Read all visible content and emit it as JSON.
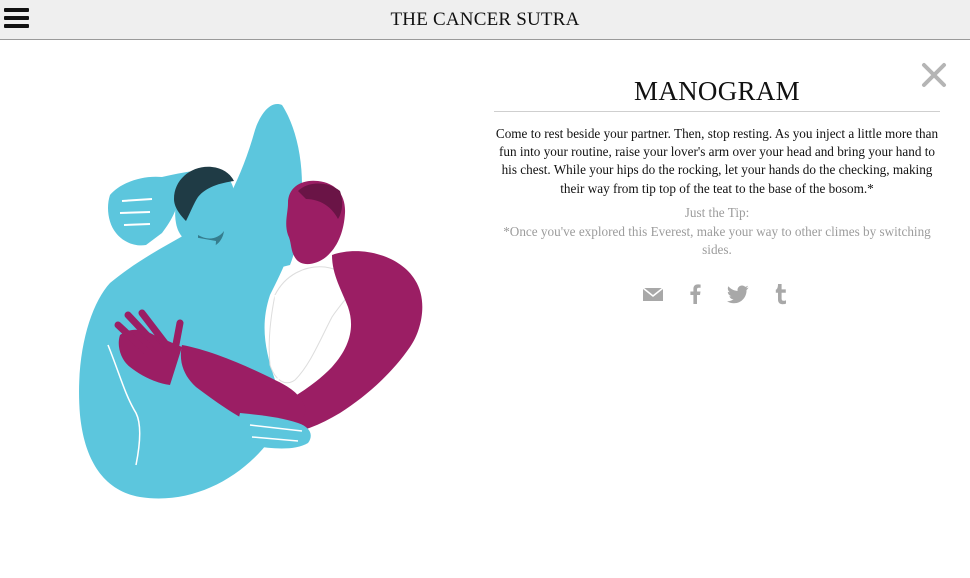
{
  "header": {
    "site_title": "THE CANCER SUTRA",
    "menu_icon": "hamburger-menu-icon"
  },
  "panel": {
    "title": "MANOGRAM",
    "description": "Come to rest beside your partner. Then, stop resting. As you inject a little more than fun into your routine, raise your lover's arm over your head and bring your hand to his chest. While your hips do the rocking, let your hands do the checking, making their way from tip top of the teat to the base of the bosom.*",
    "tip_heading": "Just the Tip:",
    "tip_text": "*Once you've explored this Everest, make your way to other climes by switching sides.",
    "close_icon": "close-icon"
  },
  "share": [
    {
      "name": "email-share-icon"
    },
    {
      "name": "facebook-share-icon"
    },
    {
      "name": "twitter-share-icon"
    },
    {
      "name": "tumblr-share-icon"
    }
  ],
  "colors": {
    "header_bg": "#efefef",
    "figure_blue": "#5cc6dd",
    "figure_purple": "#9b1e64",
    "hair_dark": "#1f3b45",
    "icon_gray": "#a8a8a8",
    "tip_gray": "#9c9c9c"
  }
}
